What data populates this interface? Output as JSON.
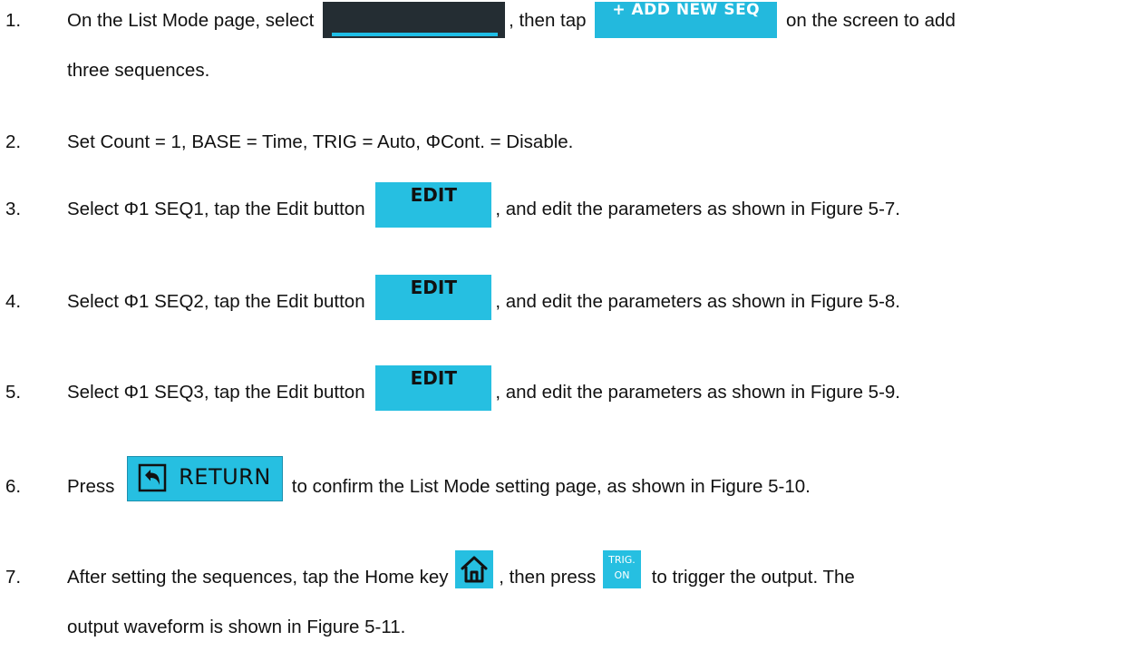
{
  "steps": [
    {
      "num": "1.",
      "pre": "On the List Mode page, select ",
      "mid": ", then tap ",
      "post": " on the screen to add",
      "cont": "three sequences.",
      "add_label": "+ ADD NEW SEQ"
    },
    {
      "num": "2.",
      "text": "Set Count = 1, BASE = Time, TRIG = Auto, ΦCont. = Disable."
    },
    {
      "num": "3.",
      "pre": "Select Φ1 SEQ1, tap the Edit button ",
      "post": ", and edit the parameters as shown in Figure 5-7.",
      "edit_label": "EDIT"
    },
    {
      "num": "4.",
      "pre": "Select Φ1 SEQ2, tap the Edit button ",
      "post": ", and edit the parameters as shown in Figure 5-8.",
      "edit_label": "EDIT"
    },
    {
      "num": "5.",
      "pre": "Select Φ1 SEQ3, tap the Edit button ",
      "post": ", and edit the parameters as shown in Figure 5-9.",
      "edit_label": "EDIT"
    },
    {
      "num": "6.",
      "pre": "Press ",
      "post": " to confirm the List Mode setting page, as shown in Figure 5-10.",
      "return_label": "RETURN"
    },
    {
      "num": "7.",
      "pre": "After setting the sequences, tap the Home key ",
      "mid": ", then press ",
      "post": " to trigger the output. The",
      "cont": "output waveform is shown in Figure 5-11.",
      "trig_line1": "TRIG.",
      "trig_line2": "ON"
    }
  ],
  "colors": {
    "button_cyan": "#26bfe1",
    "tab_dark": "#242d33",
    "tab_underline": "#1ebde6"
  },
  "icons": [
    "list-tab-icon",
    "add-new-seq-button",
    "edit-button",
    "return-arrow-icon",
    "home-icon",
    "trig-on-button"
  ]
}
